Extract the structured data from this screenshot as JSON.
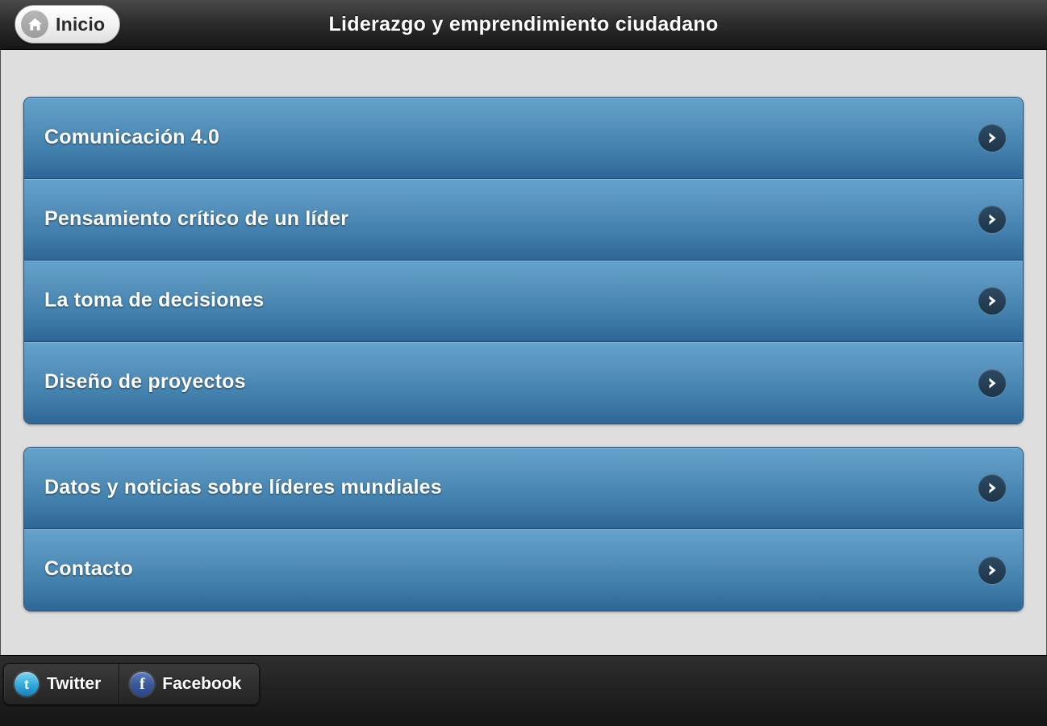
{
  "header": {
    "home_button": {
      "label": "Inicio",
      "icon": "home-icon"
    },
    "title": "Liderazgo y emprendimiento ciudadano"
  },
  "main": {
    "groups": [
      {
        "rows": [
          {
            "label": "Comunicación 4.0",
            "accessory": "chevron-right-icon"
          },
          {
            "label": "Pensamiento crítico de un líder",
            "accessory": "chevron-right-icon"
          },
          {
            "label": "La toma de decisiones",
            "accessory": "chevron-right-icon"
          },
          {
            "label": "Diseño de proyectos",
            "accessory": "chevron-right-icon"
          }
        ]
      },
      {
        "rows": [
          {
            "label": "Datos y noticias sobre líderes mundiales",
            "accessory": "chevron-right-icon"
          },
          {
            "label": "Contacto",
            "accessory": "chevron-right-icon"
          }
        ]
      }
    ]
  },
  "footer": {
    "social": [
      {
        "label": "Twitter",
        "icon": "twitter-icon",
        "glyph": "t"
      },
      {
        "label": "Facebook",
        "icon": "facebook-icon",
        "glyph": "f"
      }
    ]
  },
  "colors": {
    "row_top": "#63a3cb",
    "row_bottom": "#2f6697",
    "content_bg": "#dedede",
    "chrome_bg": "#232323",
    "text_light": "#ffffff"
  }
}
